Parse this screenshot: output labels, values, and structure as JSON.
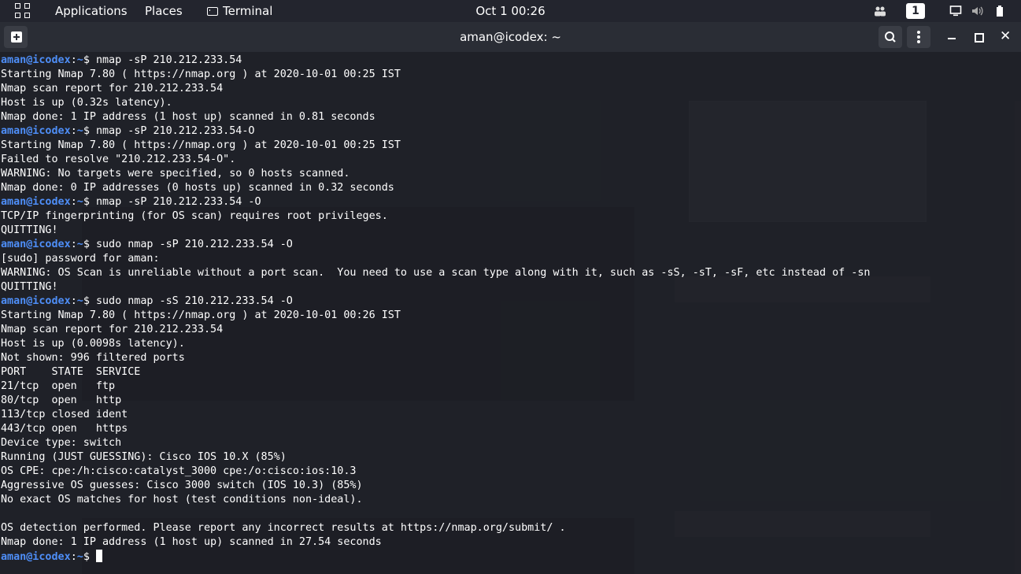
{
  "topbar": {
    "activities_icon": "apps-grid-icon",
    "applications": "Applications",
    "places": "Places",
    "terminal": "Terminal",
    "clock": "Oct 1  00:26",
    "workspace": "1",
    "tray_icons": [
      "people-icon",
      "display-icon",
      "volume-icon",
      "battery-icon"
    ]
  },
  "window": {
    "title": "aman@icodex: ~",
    "buttons": [
      "new-tab-icon",
      "search-icon",
      "menu-icon",
      "minimize-icon",
      "maximize-icon",
      "close-icon"
    ]
  },
  "colors": {
    "prompt": "#4e8ef7",
    "text": "#ffffff",
    "background": "#181a21"
  },
  "terminal": {
    "prompt_user": "aman@icodex",
    "prompt_path": "~",
    "lines": [
      {
        "type": "cmd",
        "text": "nmap -sP 210.212.233.54"
      },
      {
        "type": "out",
        "text": "Starting Nmap 7.80 ( https://nmap.org ) at 2020-10-01 00:25 IST"
      },
      {
        "type": "out",
        "text": "Nmap scan report for 210.212.233.54"
      },
      {
        "type": "out",
        "text": "Host is up (0.32s latency)."
      },
      {
        "type": "out",
        "text": "Nmap done: 1 IP address (1 host up) scanned in 0.81 seconds"
      },
      {
        "type": "cmd",
        "text": "nmap -sP 210.212.233.54-O"
      },
      {
        "type": "out",
        "text": "Starting Nmap 7.80 ( https://nmap.org ) at 2020-10-01 00:25 IST"
      },
      {
        "type": "out",
        "text": "Failed to resolve \"210.212.233.54-O\"."
      },
      {
        "type": "out",
        "text": "WARNING: No targets were specified, so 0 hosts scanned."
      },
      {
        "type": "out",
        "text": "Nmap done: 0 IP addresses (0 hosts up) scanned in 0.32 seconds"
      },
      {
        "type": "cmd",
        "text": "nmap -sP 210.212.233.54 -O"
      },
      {
        "type": "out",
        "text": "TCP/IP fingerprinting (for OS scan) requires root privileges."
      },
      {
        "type": "out",
        "text": "QUITTING!"
      },
      {
        "type": "cmd",
        "text": "sudo nmap -sP 210.212.233.54 -O"
      },
      {
        "type": "out",
        "text": "[sudo] password for aman:"
      },
      {
        "type": "out",
        "text": "WARNING: OS Scan is unreliable without a port scan.  You need to use a scan type along with it, such as -sS, -sT, -sF, etc instead of -sn"
      },
      {
        "type": "out",
        "text": "QUITTING!"
      },
      {
        "type": "cmd",
        "text": "sudo nmap -sS 210.212.233.54 -O"
      },
      {
        "type": "out",
        "text": "Starting Nmap 7.80 ( https://nmap.org ) at 2020-10-01 00:26 IST"
      },
      {
        "type": "out",
        "text": "Nmap scan report for 210.212.233.54"
      },
      {
        "type": "out",
        "text": "Host is up (0.0098s latency)."
      },
      {
        "type": "out",
        "text": "Not shown: 996 filtered ports"
      },
      {
        "type": "out",
        "text": "PORT    STATE  SERVICE"
      },
      {
        "type": "out",
        "text": "21/tcp  open   ftp"
      },
      {
        "type": "out",
        "text": "80/tcp  open   http"
      },
      {
        "type": "out",
        "text": "113/tcp closed ident"
      },
      {
        "type": "out",
        "text": "443/tcp open   https"
      },
      {
        "type": "out",
        "text": "Device type: switch"
      },
      {
        "type": "out",
        "text": "Running (JUST GUESSING): Cisco IOS 10.X (85%)"
      },
      {
        "type": "out",
        "text": "OS CPE: cpe:/h:cisco:catalyst_3000 cpe:/o:cisco:ios:10.3"
      },
      {
        "type": "out",
        "text": "Aggressive OS guesses: Cisco 3000 switch (IOS 10.3) (85%)"
      },
      {
        "type": "out",
        "text": "No exact OS matches for host (test conditions non-ideal)."
      },
      {
        "type": "out",
        "text": ""
      },
      {
        "type": "out",
        "text": "OS detection performed. Please report any incorrect results at https://nmap.org/submit/ ."
      },
      {
        "type": "out",
        "text": "Nmap done: 1 IP address (1 host up) scanned in 27.54 seconds"
      },
      {
        "type": "cmd",
        "text": ""
      }
    ]
  }
}
